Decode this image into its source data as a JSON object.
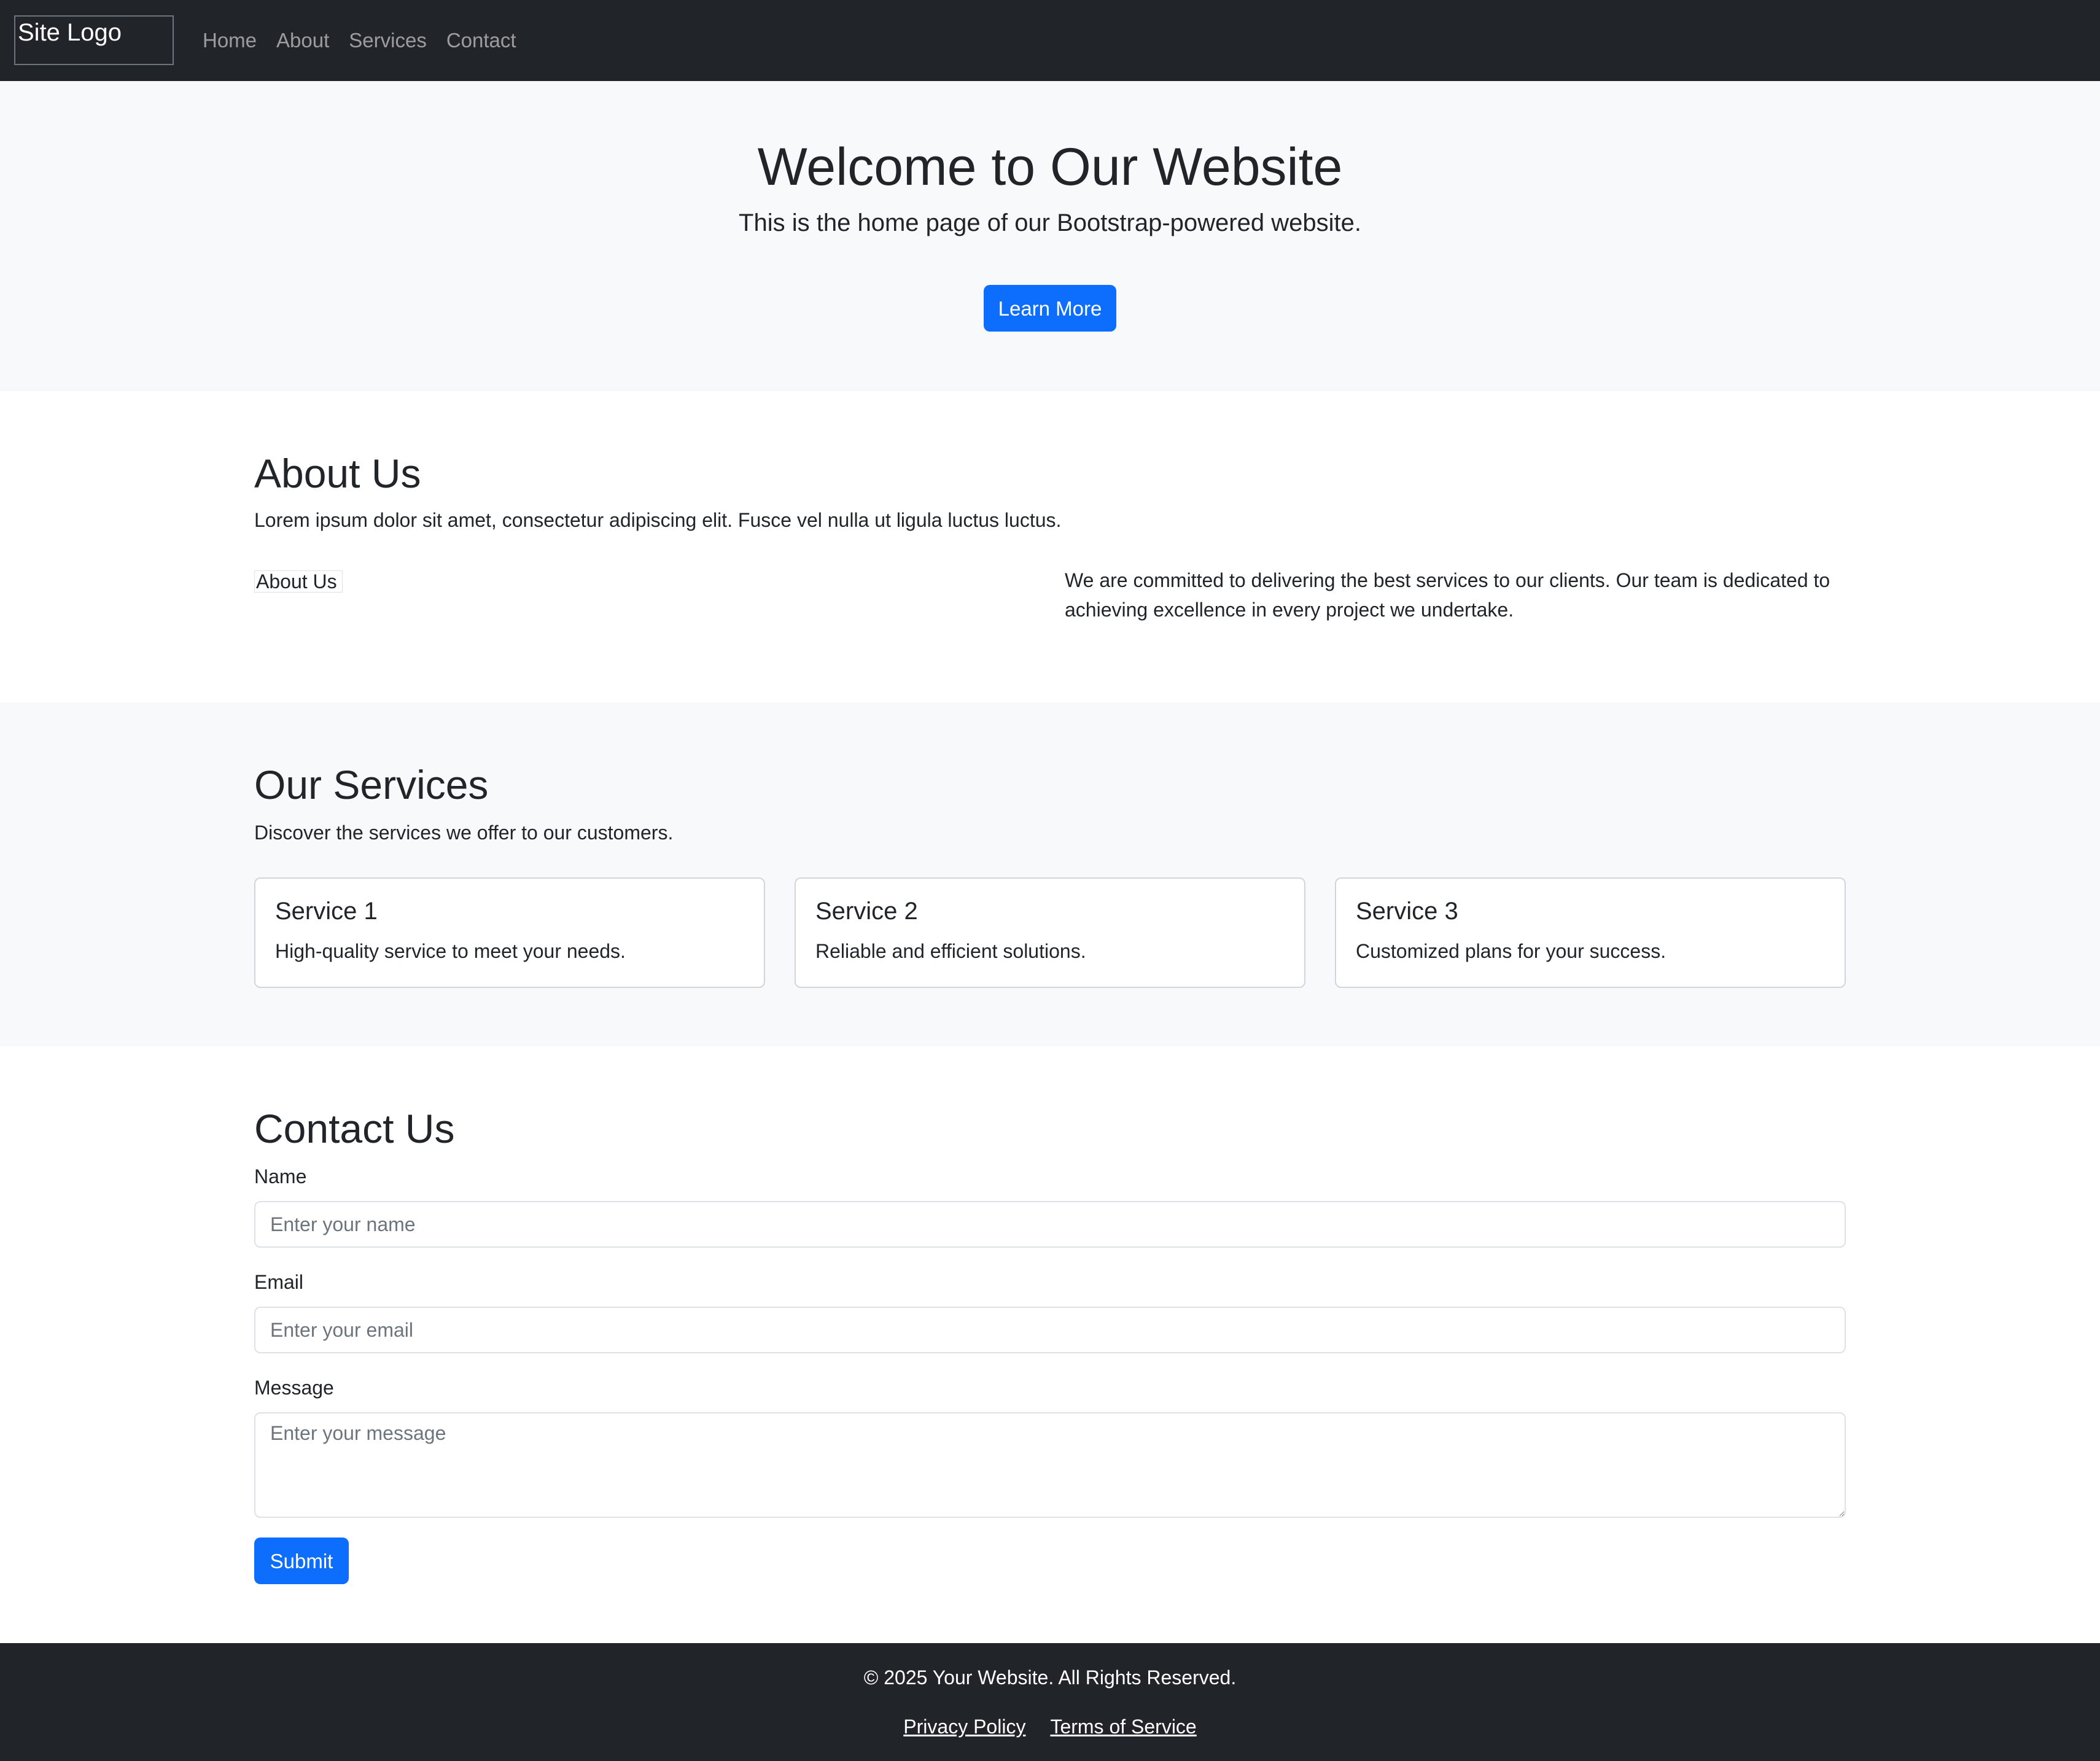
{
  "navbar": {
    "logo_text": "Site Logo",
    "links": [
      "Home",
      "About",
      "Services",
      "Contact"
    ]
  },
  "hero": {
    "title": "Welcome to Our Website",
    "subtitle": "This is the home page of our Bootstrap-powered website.",
    "button_label": "Learn More",
    "button_color": "#0d6efd"
  },
  "about": {
    "title": "About Us",
    "lead": "Lorem ipsum dolor sit amet, consectetur adipiscing elit. Fusce vel nulla ut ligula luctus luctus.",
    "image_alt": "About Us",
    "text": "We are committed to delivering the best services to our clients. Our team is dedicated to achieving excellence in every project we undertake."
  },
  "services": {
    "title": "Our Services",
    "lead": "Discover the services we offer to our customers.",
    "cards": [
      {
        "title": "Service 1",
        "text": "High-quality service to meet your needs."
      },
      {
        "title": "Service 2",
        "text": "Reliable and efficient solutions."
      },
      {
        "title": "Service 3",
        "text": "Customized plans for your success."
      }
    ]
  },
  "contact": {
    "title": "Contact Us",
    "name_label": "Name",
    "name_placeholder": "Enter your name",
    "email_label": "Email",
    "email_placeholder": "Enter your email",
    "message_label": "Message",
    "message_placeholder": "Enter your message",
    "submit_label": "Submit"
  },
  "footer": {
    "copyright": "© 2025 Your Website. All Rights Reserved.",
    "links": [
      "Privacy Policy",
      "Terms of Service"
    ]
  },
  "colors": {
    "dark": "#212529",
    "light": "#f8f9fa",
    "primary": "#0d6efd"
  }
}
